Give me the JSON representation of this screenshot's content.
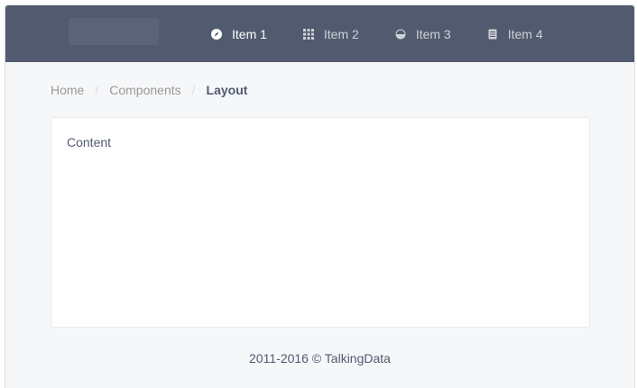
{
  "header": {
    "nav": [
      {
        "label": "Item 1",
        "icon": "compass-icon",
        "active": true
      },
      {
        "label": "Item 2",
        "icon": "grid-icon",
        "active": false
      },
      {
        "label": "Item 3",
        "icon": "pie-chart-icon",
        "active": false
      },
      {
        "label": "Item 4",
        "icon": "document-icon",
        "active": false
      }
    ]
  },
  "breadcrumb": {
    "items": [
      "Home",
      "Components",
      "Layout"
    ],
    "separator": "/"
  },
  "main": {
    "content_text": "Content"
  },
  "footer": {
    "text": "2011-2016 © TalkingData"
  },
  "colors": {
    "header_bg": "#515a6e",
    "page_bg": "#f5f7f9"
  }
}
